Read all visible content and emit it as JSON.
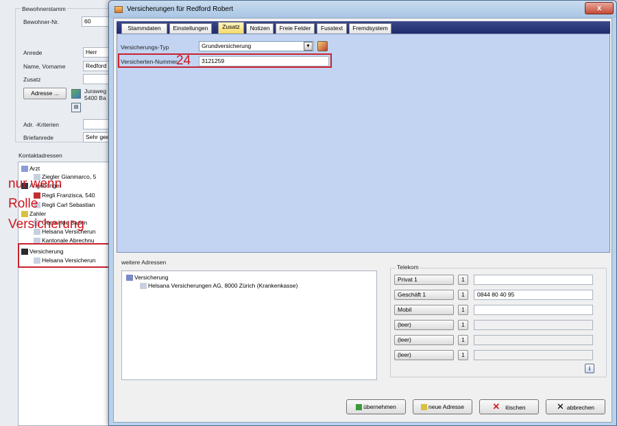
{
  "bg": {
    "group_title": "Bewohnerstamm",
    "labels": {
      "resident_no": "Bewohner-Nr.",
      "salutation": "Anrede",
      "name": "Name, Vorname",
      "addition": "Zusatz",
      "addr_criteria": "Adr. -Kriterien",
      "letter_salutation": "Briefanrede"
    },
    "values": {
      "resident_no": "60",
      "salutation": "Herr",
      "name": "Redford",
      "addition": "",
      "addr_line1": "Juraweg",
      "addr_line2": "5400 Ba",
      "addr_criteria": "",
      "letter_salutation": "Sehr gee"
    },
    "address_button": "Adresse ...",
    "contacts_title": "Kontaktadressen",
    "tree": [
      {
        "label": "Arzt",
        "level": 0
      },
      {
        "label": "Ziegler Gianmarco, 5",
        "level": 1
      },
      {
        "label": "Angehöriger",
        "level": 0
      },
      {
        "label": "Regli Franzisca, 540",
        "level": 1
      },
      {
        "label": "Regli Carl Sebastian",
        "level": 1
      },
      {
        "label": "Zahler",
        "level": 0
      },
      {
        "label": "Gemeinde Baden",
        "level": 1
      },
      {
        "label": "Helsana Versicherun",
        "level": 1
      },
      {
        "label": "Kantonale Abrechnu",
        "level": 1
      },
      {
        "label": "Versicherung",
        "level": 0
      },
      {
        "label": "Helsana Versicherun",
        "level": 1
      }
    ]
  },
  "dialog": {
    "title": "Versicherungen für Redford Robert",
    "close": "x",
    "tabs": [
      "Stammdaten",
      "Einstellungen",
      "Zusatz",
      "Notizen",
      "Freie Felder",
      "Fusstext",
      "Fremdsystem"
    ],
    "active_tab": "Zusatz",
    "insurance_type_label": "Versicherungs-Typ",
    "insurance_type_value": "Grundversicherung",
    "insured_number_label": "Versicherten-Nummer",
    "insured_number_value": "3121259",
    "further_addresses_title": "weitere Adressen",
    "further_tree_root": "Versicherung",
    "further_tree_child": "Helsana Versicherungen AG, 8000 Zürich (Krankenkasse)",
    "telecom_title": "Telekom",
    "telecom": [
      {
        "label": "Privat 1",
        "value": "",
        "enabled": true
      },
      {
        "label": "Geschäft 1",
        "value": "0844 80 40 95",
        "enabled": true
      },
      {
        "label": "Mobil",
        "value": "",
        "enabled": true
      },
      {
        "label": "(leer)",
        "value": "",
        "enabled": false
      },
      {
        "label": "(leer)",
        "value": "",
        "enabled": false
      },
      {
        "label": "(leer)",
        "value": "",
        "enabled": false
      }
    ],
    "call_glyph": "1",
    "buttons": {
      "apply": "übernehmen",
      "new_address": "neue Adresse",
      "delete": "löschen",
      "cancel": "abbrechen"
    }
  },
  "annotations": {
    "number": "24",
    "note_line1": "nur wenn",
    "note_line2": "Rolle",
    "note_line3": "Versicherung"
  },
  "colors": {
    "annotation_red": "#d0141c",
    "tab_strip": "#1e2a6b",
    "tab_page": "#c2d4f2"
  }
}
